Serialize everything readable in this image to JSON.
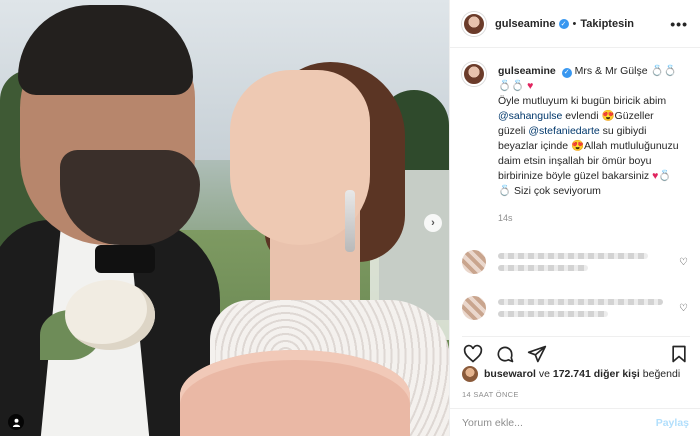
{
  "post": {
    "username": "gulseamine",
    "follow_state": "Takiptesin",
    "more_icon": "•••"
  },
  "caption": {
    "username": "gulseamine",
    "segments": {
      "s1": "Mrs & Mr Gülşe",
      "s1_glyphs": "💍💍💍💍",
      "s2": "Öyle mutluyum ki bugün biricik abim",
      "mention1": "@sahangulse",
      "s3": " evlendi 😍Güzeller güzeli",
      "mention2": "@stefaniedarte",
      "s4": " su gibiydi beyazlar içinde 😍Allah mutluluğunuzu daim etsin inşallah bir ömür boyu birbirinize böyle güzel bakarsiniz ",
      "s5": " Sizi çok seviyorum ",
      "heart": "♥",
      "s5_glyphs": "💍💍"
    },
    "time": "14s"
  },
  "likes": {
    "user": "busewarol",
    "mid": " ve ",
    "count": "172.741 diğer kişi",
    "tail": " beğendi"
  },
  "timestamp": "14 SAAT ÖNCE",
  "comment_box": {
    "placeholder": "Yorum ekle...",
    "post_label": "Paylaş"
  },
  "icons": {
    "verified": "✓",
    "nav_next": "›",
    "tag": "👤"
  }
}
